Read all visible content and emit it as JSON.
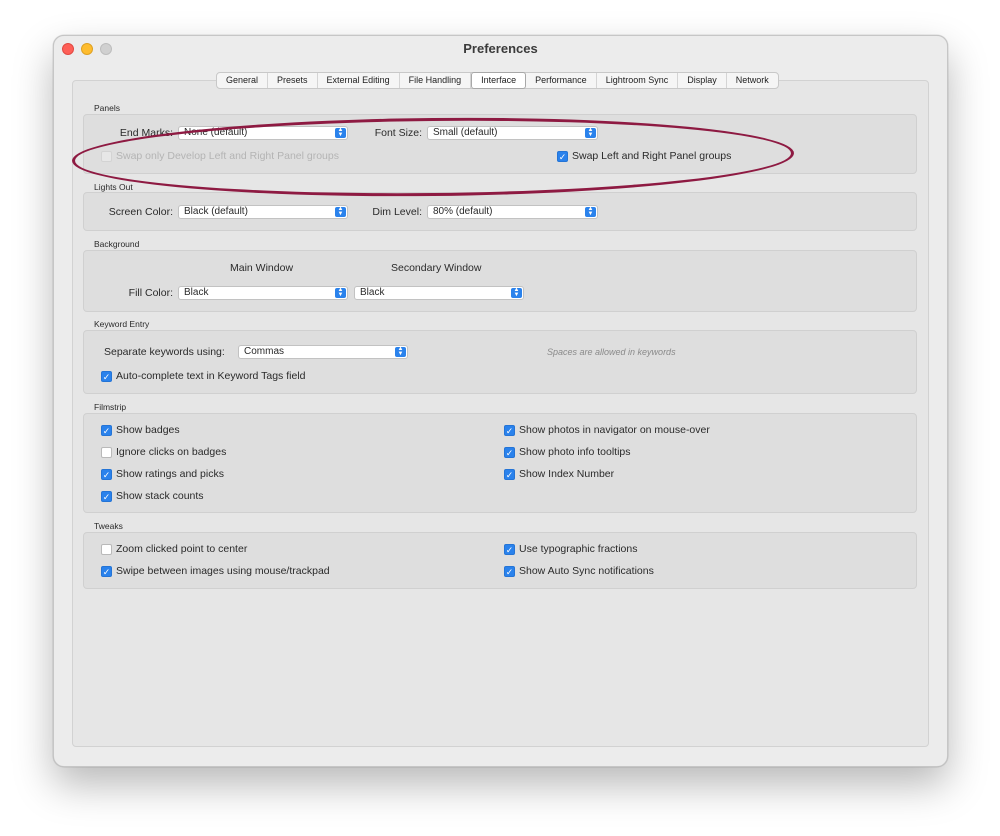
{
  "window": {
    "title": "Preferences"
  },
  "tabs": [
    "General",
    "Presets",
    "External Editing",
    "File Handling",
    "Interface",
    "Performance",
    "Lightroom Sync",
    "Display",
    "Network"
  ],
  "active_tab": "Interface",
  "panels": {
    "title": "Panels",
    "end_marks_label": "End Marks:",
    "end_marks_value": "None (default)",
    "font_size_label": "Font Size:",
    "font_size_value": "Small (default)",
    "swap_develop_label": "Swap only Develop Left and Right Panel groups",
    "swap_panels_label": "Swap Left and Right Panel groups"
  },
  "lights_out": {
    "title": "Lights Out",
    "screen_color_label": "Screen Color:",
    "screen_color_value": "Black (default)",
    "dim_level_label": "Dim Level:",
    "dim_level_value": "80% (default)"
  },
  "background": {
    "title": "Background",
    "main_window_label": "Main Window",
    "secondary_window_label": "Secondary Window",
    "fill_color_label": "Fill Color:",
    "main_fill_value": "Black",
    "secondary_fill_value": "Black"
  },
  "keyword_entry": {
    "title": "Keyword Entry",
    "separate_label": "Separate keywords using:",
    "separate_value": "Commas",
    "hint": "Spaces are allowed in keywords",
    "autocomplete_label": "Auto-complete text in Keyword Tags field"
  },
  "filmstrip": {
    "title": "Filmstrip",
    "show_badges": "Show badges",
    "ignore_clicks": "Ignore clicks on badges",
    "show_ratings": "Show ratings and picks",
    "show_stack": "Show stack counts",
    "show_navigator": "Show photos in navigator on mouse-over",
    "show_tooltips": "Show photo info tooltips",
    "show_index": "Show Index Number"
  },
  "tweaks": {
    "title": "Tweaks",
    "zoom_clicked": "Zoom clicked point to center",
    "swipe": "Swipe between images using mouse/trackpad",
    "typographic": "Use typographic fractions",
    "auto_sync": "Show Auto Sync notifications"
  },
  "icons": {
    "checkmark": "✓",
    "dropdown": "⌃⌄"
  },
  "colors": {
    "accent": "#2a82ec",
    "annotation_oval": "#8e1a42",
    "close": "#fe5f57",
    "minimize": "#febc2e"
  }
}
